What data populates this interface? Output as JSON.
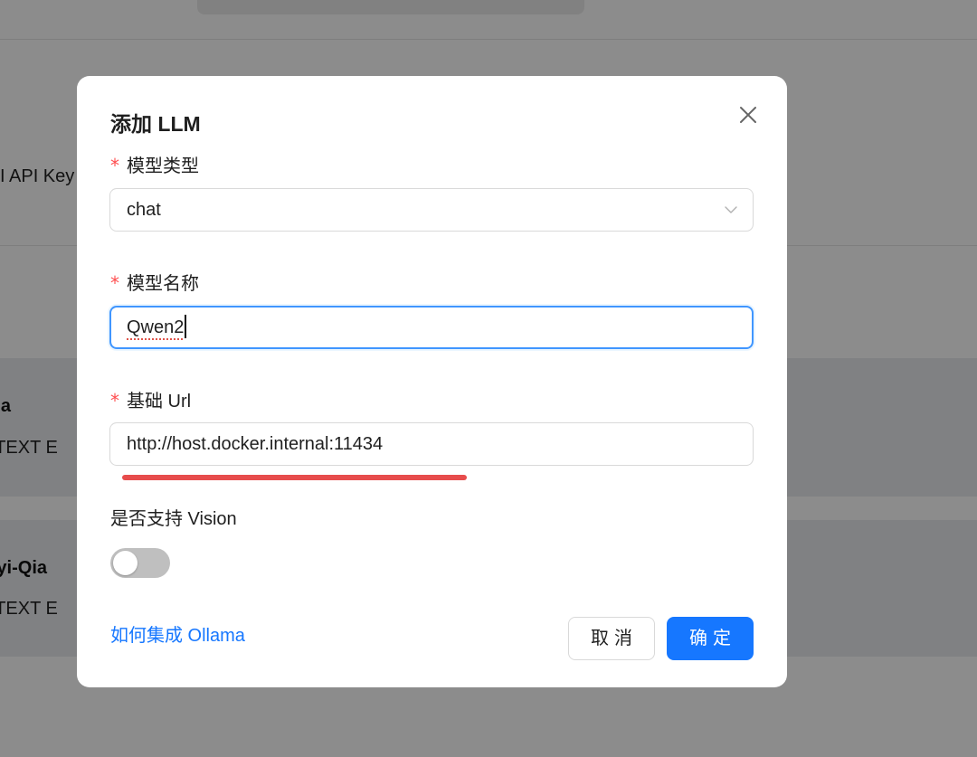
{
  "background": {
    "api_key_label": "I API Key",
    "cards": [
      {
        "title": "ama",
        "tags": "M,TEXT E"
      },
      {
        "title": "ngyi-Qia",
        "tags": "M,TEXT E"
      }
    ]
  },
  "dialog": {
    "title": "添加 LLM",
    "required_marker": "*",
    "model_type": {
      "label": "模型类型",
      "value": "chat"
    },
    "model_name": {
      "label": "模型名称",
      "value": "Qwen2"
    },
    "base_url": {
      "label": "基础 Url",
      "value": "http://host.docker.internal:11434"
    },
    "vision": {
      "label": "是否支持 Vision",
      "enabled": false
    },
    "help_link": "如何集成 Ollama",
    "cancel_label": "取消",
    "ok_label": "确定"
  },
  "colors": {
    "primary": "#1677ff",
    "required": "#ff4d4f",
    "annotation_underline": "#e74c4c",
    "toggle_off": "#bfbfbf"
  },
  "icons": {
    "close": "close-icon",
    "dropdown": "chevron-down-icon"
  }
}
